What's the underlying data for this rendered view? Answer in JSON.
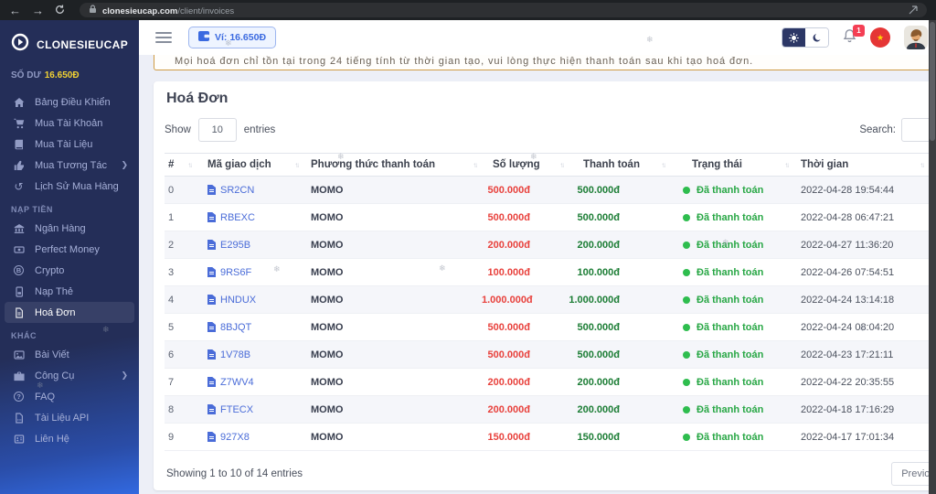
{
  "browser": {
    "domain": "clonesieucap.com",
    "path": "/client/invoices"
  },
  "sidebar": {
    "brand": "CLONESIEUCAP",
    "balance_label": "SỐ DƯ",
    "balance_value": "16.650Đ",
    "menu": [
      {
        "label": "Bảng Điều Khiển"
      },
      {
        "label": "Mua Tài Khoản"
      },
      {
        "label": "Mua Tài Liệu"
      },
      {
        "label": "Mua Tương Tác"
      },
      {
        "label": "Lịch Sử Mua Hàng"
      }
    ],
    "section_naptien": "NẠP TIỀN",
    "menu_naptien": [
      {
        "label": "Ngân Hàng"
      },
      {
        "label": "Perfect Money"
      },
      {
        "label": "Crypto"
      },
      {
        "label": "Nạp Thẻ"
      },
      {
        "label": "Hoá Đơn"
      }
    ],
    "section_khac": "KHÁC",
    "menu_khac": [
      {
        "label": "Bài Viết"
      },
      {
        "label": "Công Cụ"
      },
      {
        "label": "FAQ"
      },
      {
        "label": "Tài Liệu API"
      },
      {
        "label": "Liên Hệ"
      }
    ]
  },
  "topbar": {
    "wallet": "Ví: 16.650Đ",
    "badge": "1"
  },
  "alert": "Mọi hoá đơn chỉ tồn tại trong 24 tiếng tính từ thời gian tạo, vui lòng thực hiện thanh toán sau khi tạo hoá đơn.",
  "page": {
    "title": "Hoá Đơn",
    "show": "Show",
    "entries": "entries",
    "length": "10",
    "search": "Search:",
    "columns": [
      "#",
      "Mã giao dịch",
      "Phương thức thanh toán",
      "Số lượng",
      "Thanh toán",
      "Trạng thái",
      "Thời gian"
    ],
    "rows": [
      {
        "i": "0",
        "code": "SR2CN",
        "method": "MOMO",
        "qty": "500.000đ",
        "pay": "500.000đ",
        "status": "Đã thanh toán",
        "time": "2022-04-28 19:54:44"
      },
      {
        "i": "1",
        "code": "RBEXC",
        "method": "MOMO",
        "qty": "500.000đ",
        "pay": "500.000đ",
        "status": "Đã thanh toán",
        "time": "2022-04-28 06:47:21"
      },
      {
        "i": "2",
        "code": "E295B",
        "method": "MOMO",
        "qty": "200.000đ",
        "pay": "200.000đ",
        "status": "Đã thanh toán",
        "time": "2022-04-27 11:36:20"
      },
      {
        "i": "3",
        "code": "9RS6F",
        "method": "MOMO",
        "qty": "100.000đ",
        "pay": "100.000đ",
        "status": "Đã thanh toán",
        "time": "2022-04-26 07:54:51"
      },
      {
        "i": "4",
        "code": "HNDUX",
        "method": "MOMO",
        "qty": "1.000.000đ",
        "pay": "1.000.000đ",
        "status": "Đã thanh toán",
        "time": "2022-04-24 13:14:18"
      },
      {
        "i": "5",
        "code": "8BJQT",
        "method": "MOMO",
        "qty": "500.000đ",
        "pay": "500.000đ",
        "status": "Đã thanh toán",
        "time": "2022-04-24 08:04:20"
      },
      {
        "i": "6",
        "code": "1V78B",
        "method": "MOMO",
        "qty": "500.000đ",
        "pay": "500.000đ",
        "status": "Đã thanh toán",
        "time": "2022-04-23 17:21:11"
      },
      {
        "i": "7",
        "code": "Z7WV4",
        "method": "MOMO",
        "qty": "200.000đ",
        "pay": "200.000đ",
        "status": "Đã thanh toán",
        "time": "2022-04-22 20:35:55"
      },
      {
        "i": "8",
        "code": "FTECX",
        "method": "MOMO",
        "qty": "200.000đ",
        "pay": "200.000đ",
        "status": "Đã thanh toán",
        "time": "2022-04-18 17:16:29"
      },
      {
        "i": "9",
        "code": "927X8",
        "method": "MOMO",
        "qty": "150.000đ",
        "pay": "150.000đ",
        "status": "Đã thanh toán",
        "time": "2022-04-17 17:01:34"
      }
    ],
    "summary": "Showing 1 to 10 of 14 entries",
    "previous": "Previous"
  },
  "decor": {
    "snowflake": "❄",
    "crypto_letter": "B",
    "faq_mark": "?",
    "history_glyph": "↺",
    "star": "★",
    "back": "←",
    "forward": "→"
  },
  "colors": {
    "accent_blue": "#3b6ae0",
    "danger_red": "#e8413c",
    "success_green": "#28a745",
    "pay_green": "#1c7d35",
    "warning_border": "#cf9c45",
    "balance_yellow": "#f2d233"
  }
}
